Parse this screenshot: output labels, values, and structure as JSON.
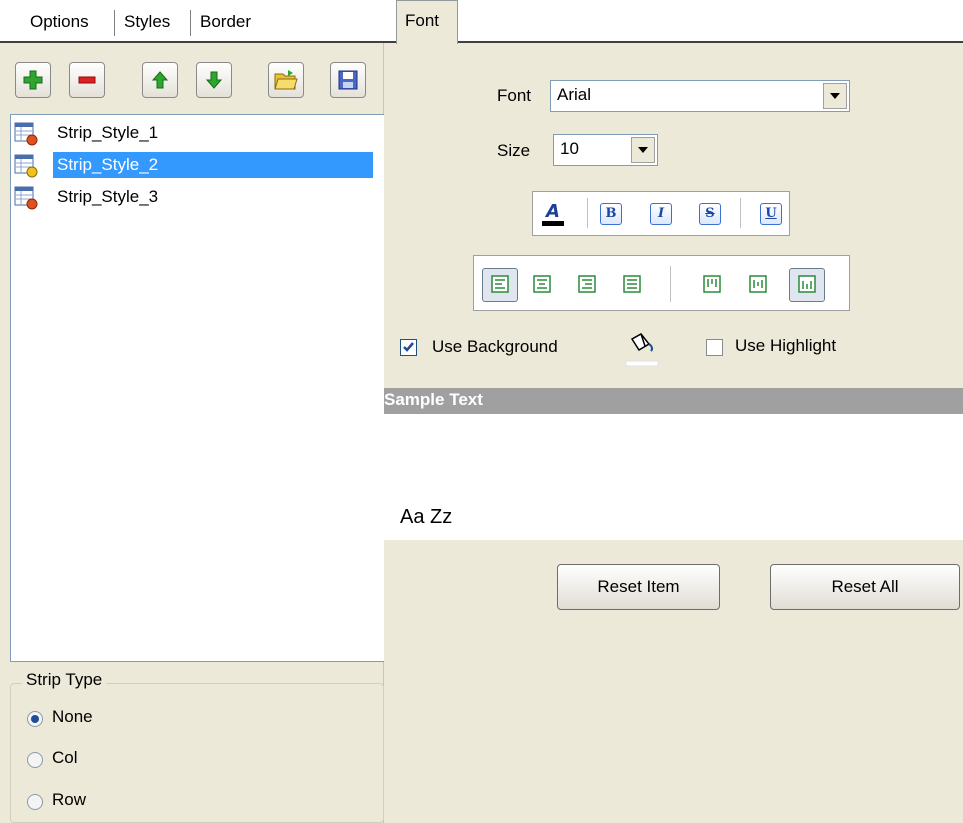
{
  "tabs_left": [
    {
      "label": "Options"
    },
    {
      "label": "Styles"
    },
    {
      "label": "Border"
    }
  ],
  "tab_right": {
    "label": "Font"
  },
  "toolbar": {
    "buttons": [
      "add-icon",
      "remove-icon",
      "move-up-icon",
      "move-down-icon",
      "open-folder-icon",
      "save-icon"
    ]
  },
  "styles_list": {
    "items": [
      {
        "label": "Strip_Style_1",
        "selected": false
      },
      {
        "label": "Strip_Style_2",
        "selected": true
      },
      {
        "label": "Strip_Style_3",
        "selected": false
      }
    ]
  },
  "strip_type": {
    "title": "Strip Type",
    "options": [
      {
        "label": "None",
        "checked": true
      },
      {
        "label": "Col",
        "checked": false
      },
      {
        "label": "Row",
        "checked": false
      }
    ]
  },
  "font": {
    "font_label": "Font",
    "font_value": "Arial",
    "size_label": "Size",
    "size_value": "10",
    "style_buttons": [
      "font-color-icon",
      "bold-icon",
      "italic-icon",
      "strikeout-icon",
      "underline-icon"
    ],
    "align_buttons": [
      "align-left-icon",
      "align-center-icon",
      "align-right-icon",
      "align-justify-icon",
      "valign-top-icon",
      "valign-center-icon",
      "valign-bottom-icon"
    ],
    "style_glyphs": {
      "bold": "B",
      "italic": "I",
      "strike": "S",
      "underline": "U"
    }
  },
  "background": {
    "use_background_label": "Use Background",
    "use_background_checked": true,
    "use_highlight_label": "Use Highlight",
    "use_highlight_checked": false
  },
  "sample": {
    "header": "Sample Text",
    "text": "Aa Zz"
  },
  "buttons": {
    "reset_item": "Reset Item",
    "reset_all": "Reset All"
  },
  "colors": {
    "panel": "#ece9d8",
    "selection": "#3399ff",
    "sample_header": "#a0a0a0"
  }
}
